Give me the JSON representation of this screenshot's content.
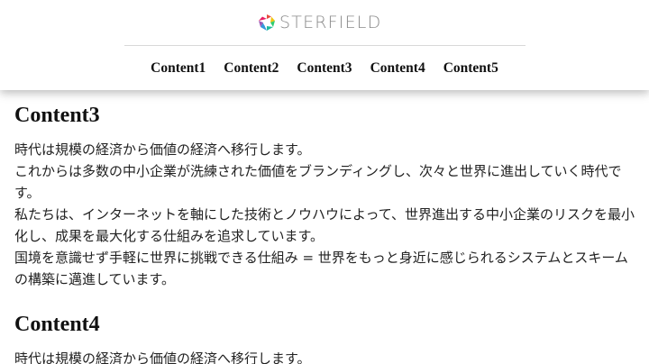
{
  "brand": {
    "logo_text": "STERFIELD",
    "logo_icon": "multicolor-ring-icon"
  },
  "nav": {
    "items": [
      "Content1",
      "Content2",
      "Content3",
      "Content4",
      "Content5"
    ]
  },
  "sections": [
    {
      "heading": "Content3",
      "lines": [
        "時代は規模の経済から価値の経済へ移行します。",
        "これからは多数の中小企業が洗練された価値をブランディングし、次々と世界に進出していく時代です。",
        "私たちは、インターネットを軸にした技術とノウハウによって、世界進出する中小企業のリスクを最小化し、成果を最大化する仕組みを追求しています。",
        "国境を意識せず手軽に世界に挑戦できる仕組み = 世界をもっと身近に感じられるシステムとスキームの構築に邁進しています。"
      ]
    },
    {
      "heading": "Content4",
      "lines": [
        "時代は規模の経済から価値の経済へ移行します。"
      ]
    }
  ]
}
